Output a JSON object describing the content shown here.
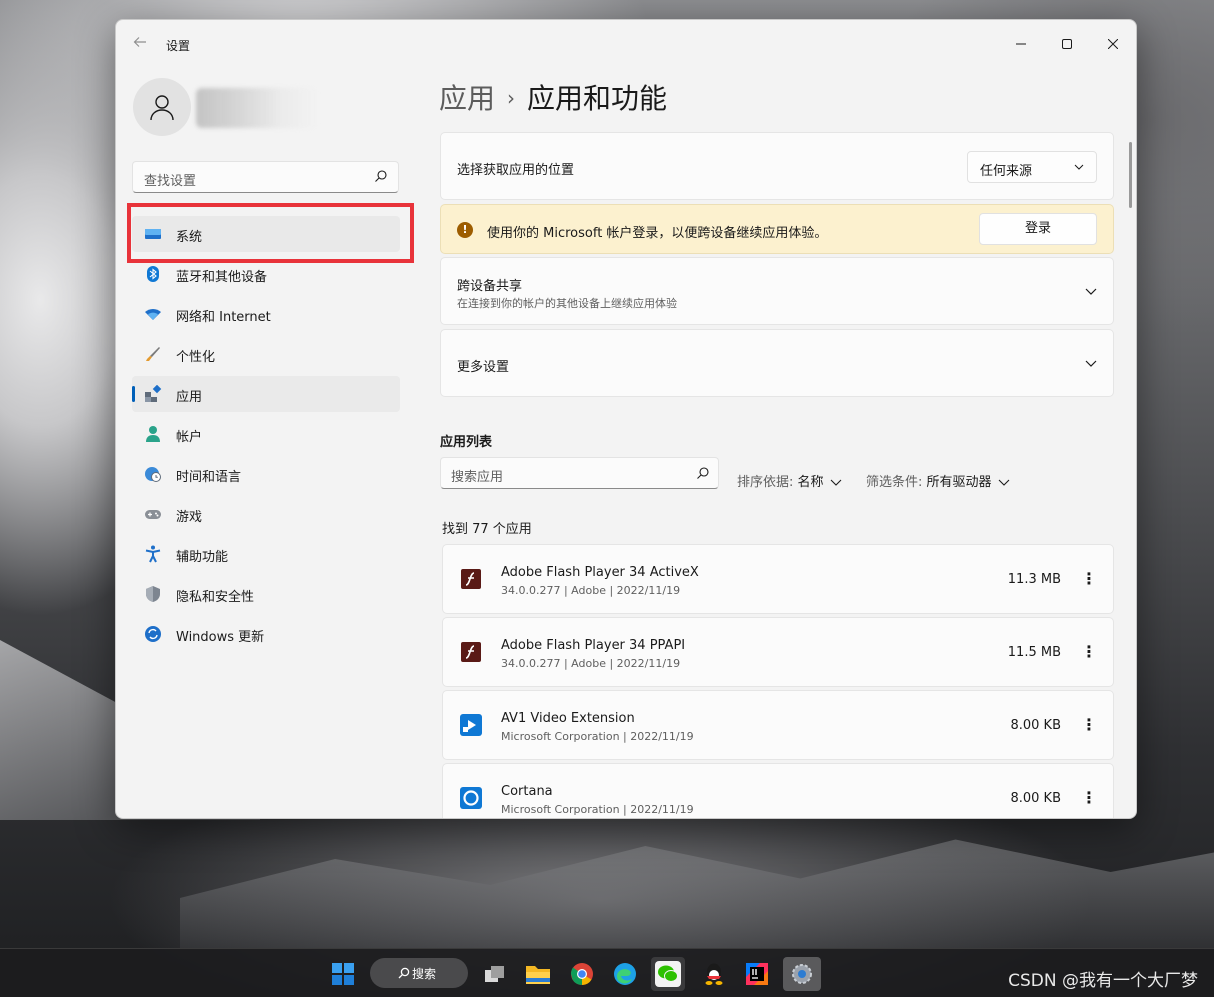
{
  "window": {
    "title": "设置"
  },
  "sidebar": {
    "search_placeholder": "查找设置",
    "items": [
      {
        "label": "系统",
        "icon": "display-icon"
      },
      {
        "label": "蓝牙和其他设备",
        "icon": "bluetooth-icon"
      },
      {
        "label": "网络和 Internet",
        "icon": "wifi-icon"
      },
      {
        "label": "个性化",
        "icon": "brush-icon"
      },
      {
        "label": "应用",
        "icon": "apps-icon"
      },
      {
        "label": "帐户",
        "icon": "account-icon"
      },
      {
        "label": "时间和语言",
        "icon": "globe-clock-icon"
      },
      {
        "label": "游戏",
        "icon": "gamepad-icon"
      },
      {
        "label": "辅助功能",
        "icon": "accessibility-icon"
      },
      {
        "label": "隐私和安全性",
        "icon": "shield-icon"
      },
      {
        "label": "Windows 更新",
        "icon": "update-icon"
      }
    ]
  },
  "breadcrumb": {
    "parent": "应用",
    "current": "应用和功能"
  },
  "install_source": {
    "label": "选择获取应用的位置",
    "value": "任何来源"
  },
  "signin_banner": {
    "message": "使用你的 Microsoft 帐户登录，以便跨设备继续应用体验。",
    "button": "登录"
  },
  "cross_device": {
    "title": "跨设备共享",
    "subtitle": "在连接到你的帐户的其他设备上继续应用体验"
  },
  "more_settings": {
    "title": "更多设置"
  },
  "app_list": {
    "heading": "应用列表",
    "search_placeholder": "搜索应用",
    "sort_label": "排序依据:",
    "sort_value": "名称",
    "filter_label": "筛选条件:",
    "filter_value": "所有驱动器",
    "found": "找到 77 个应用",
    "apps": [
      {
        "name": "Adobe Flash Player 34 ActiveX",
        "meta": "34.0.0.277  |  Adobe  |  2022/11/19",
        "size": "11.3 MB",
        "icon": "flash-icon",
        "color": "#5a1a16"
      },
      {
        "name": "Adobe Flash Player 34 PPAPI",
        "meta": "34.0.0.277  |  Adobe  |  2022/11/19",
        "size": "11.5 MB",
        "icon": "flash-icon",
        "color": "#5a1a16"
      },
      {
        "name": "AV1 Video Extension",
        "meta": "Microsoft Corporation  |  2022/11/19",
        "size": "8.00 KB",
        "icon": "video-extension-icon",
        "color": "#0f78d4"
      },
      {
        "name": "Cortana",
        "meta": "Microsoft Corporation  |  2022/11/19",
        "size": "8.00 KB",
        "icon": "cortana-icon",
        "color": "#0f78d4"
      }
    ]
  },
  "taskbar": {
    "search_label": "搜索"
  },
  "watermark": "CSDN @我有一个大厂梦",
  "colors": {
    "accent": "#005fb8",
    "highlight_box": "#e8333a",
    "banner": "#fcf1cf"
  }
}
